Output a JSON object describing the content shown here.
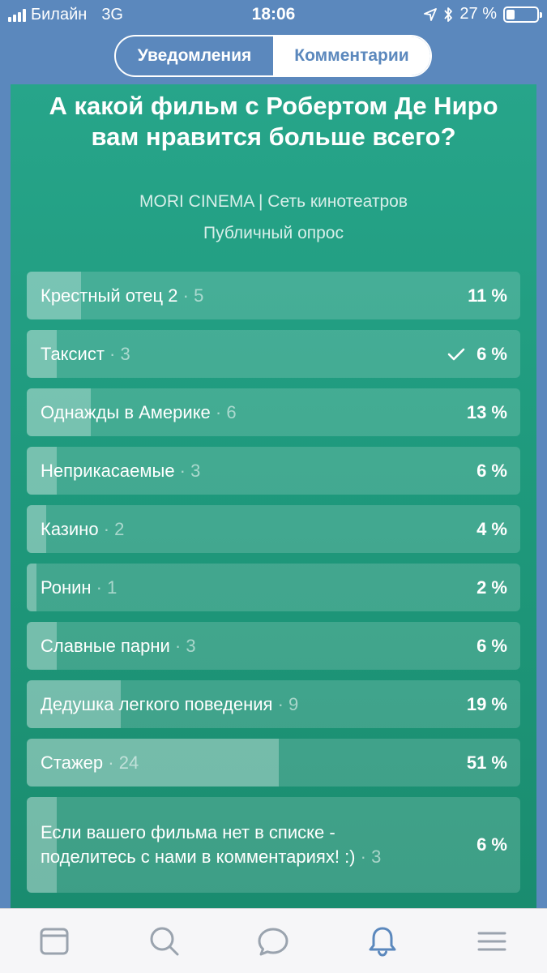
{
  "status_bar": {
    "carrier": "Билайн",
    "network": "3G",
    "time": "18:06",
    "battery": "27 %",
    "battery_level": 0.27
  },
  "segmented": {
    "tabs": [
      {
        "label": "Уведомления",
        "active": false
      },
      {
        "label": "Комментарии",
        "active": true
      }
    ]
  },
  "poll": {
    "title": "А какой фильм с Робертом Де Ниро вам нравится больше всего?",
    "author": "MORI CINEMA | Сеть кинотеатров",
    "type": "Публичный опрос",
    "options": [
      {
        "text": "Крестный отец 2",
        "count": "5",
        "percent": "11 %",
        "fraction": 0.11,
        "checked": false
      },
      {
        "text": "Таксист",
        "count": "3",
        "percent": "6 %",
        "fraction": 0.06,
        "checked": true
      },
      {
        "text": "Однажды в Америке",
        "count": "6",
        "percent": "13 %",
        "fraction": 0.13,
        "checked": false
      },
      {
        "text": "Неприкасаемые",
        "count": "3",
        "percent": "6 %",
        "fraction": 0.06,
        "checked": false
      },
      {
        "text": "Казино",
        "count": "2",
        "percent": "4 %",
        "fraction": 0.04,
        "checked": false
      },
      {
        "text": "Ронин",
        "count": "1",
        "percent": "2 %",
        "fraction": 0.02,
        "checked": false
      },
      {
        "text": "Славные парни",
        "count": "3",
        "percent": "6 %",
        "fraction": 0.06,
        "checked": false
      },
      {
        "text": "Дедушка легкого поведения",
        "count": "9",
        "percent": "19 %",
        "fraction": 0.19,
        "checked": false
      },
      {
        "text": "Стажер",
        "count": "24",
        "percent": "51 %",
        "fraction": 0.51,
        "checked": false
      },
      {
        "text": "Если вашего фильма нет в списке - поделитесь с нами в комментариях! :)",
        "count": "3",
        "percent": "6 %",
        "fraction": 0.06,
        "checked": false
      }
    ]
  },
  "tab_bar": {
    "items": [
      {
        "icon": "news-icon",
        "active": false
      },
      {
        "icon": "search-icon",
        "active": false
      },
      {
        "icon": "messages-icon",
        "active": false
      },
      {
        "icon": "bell-icon",
        "active": true
      },
      {
        "icon": "menu-icon",
        "active": false
      }
    ]
  },
  "colors": {
    "header_blue": "#5b88bd",
    "poll_green": "#1f9a7d",
    "tab_active": "#5b88bd",
    "tab_inactive": "#9aa3ae"
  }
}
